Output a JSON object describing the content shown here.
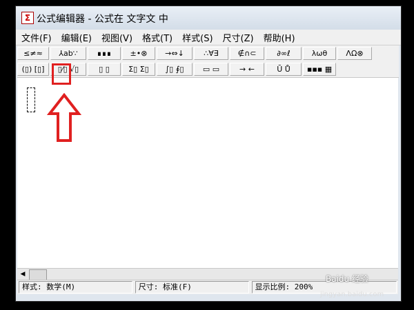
{
  "window": {
    "title": "公式编辑器 - 公式在 文字文 中",
    "icon_glyph": "Σ"
  },
  "menu": [
    "文件(F)",
    "编辑(E)",
    "视图(V)",
    "格式(T)",
    "样式(S)",
    "尺寸(Z)",
    "帮助(H)"
  ],
  "toolbar_row1": [
    "≤≠≈",
    "⅄ab∵",
    "∎∎∎",
    "±•⊗",
    "→⇔↓",
    "∴∀∃",
    "∉∩⊂",
    "∂∞ℓ",
    "λωθ",
    "ΛΩ⊗"
  ],
  "toolbar_row2": [
    "(▯) [▯]",
    "▯⁄▯ √▯",
    "▯ ▯",
    "Σ▯ Σ▯",
    "∫▯ ∮▯",
    "▭ ▭",
    "→ ←",
    "Ū Ů",
    "▪▪▪ ▦"
  ],
  "status": {
    "style": "样式: 数学(M)",
    "size": "尺寸: 标准(F)",
    "zoom": "显示比例: 200%"
  },
  "watermark": {
    "brand": "Baidu 经验",
    "url": "jingyan.baidu.com"
  },
  "colors": {
    "annotation": "#e02020"
  }
}
